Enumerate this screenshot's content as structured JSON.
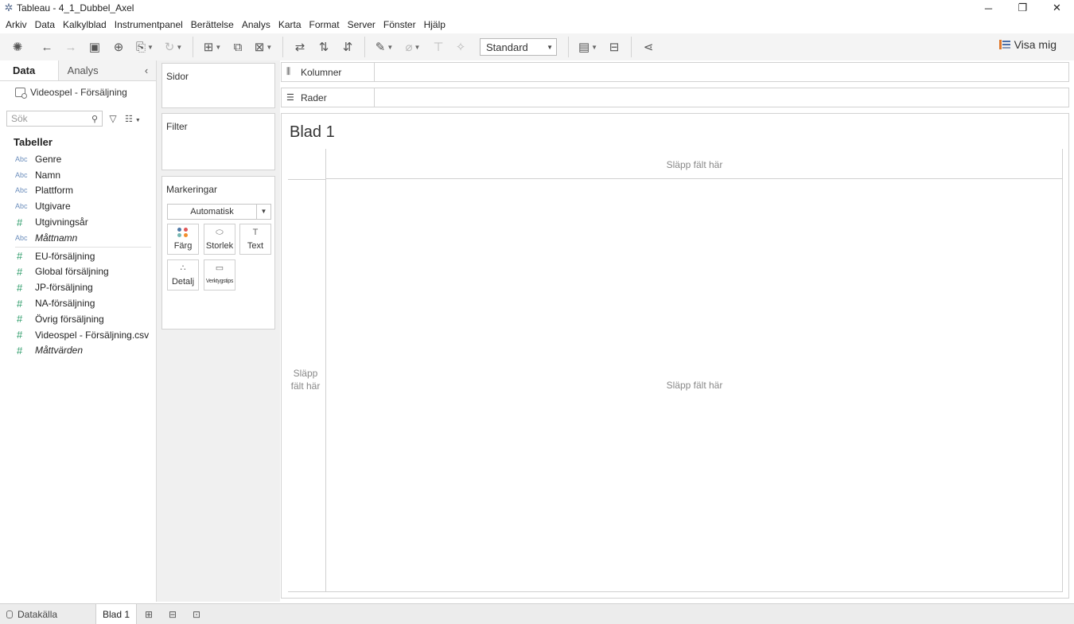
{
  "window": {
    "title": "Tableau - 4_1_Dubbel_Axel",
    "controls": [
      "─",
      "❐",
      "✕"
    ]
  },
  "menu": [
    "Arkiv",
    "Data",
    "Kalkylblad",
    "Instrumentpanel",
    "Berättelse",
    "Analys",
    "Karta",
    "Format",
    "Server",
    "Fönster",
    "Hjälp"
  ],
  "toolbar": {
    "fit_select_value": "Standard",
    "show_me_label": "Visa mig"
  },
  "data_pane": {
    "tabs": [
      "Data",
      "Analys"
    ],
    "collapse_glyph": "‹",
    "datasource": "Videospel - Försäljning",
    "search_placeholder": "Sök",
    "tables_heading": "Tabeller",
    "dimensions": [
      {
        "type": "Abc",
        "name": "Genre"
      },
      {
        "type": "Abc",
        "name": "Namn"
      },
      {
        "type": "Abc",
        "name": "Plattform"
      },
      {
        "type": "Abc",
        "name": "Utgivare"
      },
      {
        "type": "#",
        "name": "Utgivningsår"
      },
      {
        "type": "Abc",
        "name": "Måttnamn"
      }
    ],
    "measures": [
      {
        "type": "#",
        "name": "EU-försäljning"
      },
      {
        "type": "#",
        "name": "Global försäljning"
      },
      {
        "type": "#",
        "name": "JP-försäljning"
      },
      {
        "type": "#",
        "name": "NA-försäljning"
      },
      {
        "type": "#",
        "name": "Övrig försäljning"
      },
      {
        "type": "#",
        "name": "Videospel - Försäljning.csv"
      },
      {
        "type": "#",
        "name": "Måttvärden"
      }
    ]
  },
  "cards": {
    "pages": "Sidor",
    "filters": "Filter",
    "marks": "Markeringar",
    "marks_type": "Automatisk",
    "mark_buttons": [
      "Färg",
      "Storlek",
      "Text",
      "Detalj",
      "Verktygstips"
    ]
  },
  "shelves": {
    "columns": "Kolumner",
    "rows": "Rader"
  },
  "sheet": {
    "title": "Blad 1",
    "drop_columns": "Släpp fält här",
    "drop_rows": "Släpp fält här",
    "drop_body": "Släpp fält här"
  },
  "bottom": {
    "datasource_tab": "Datakälla",
    "sheet_tab": "Blad 1"
  }
}
